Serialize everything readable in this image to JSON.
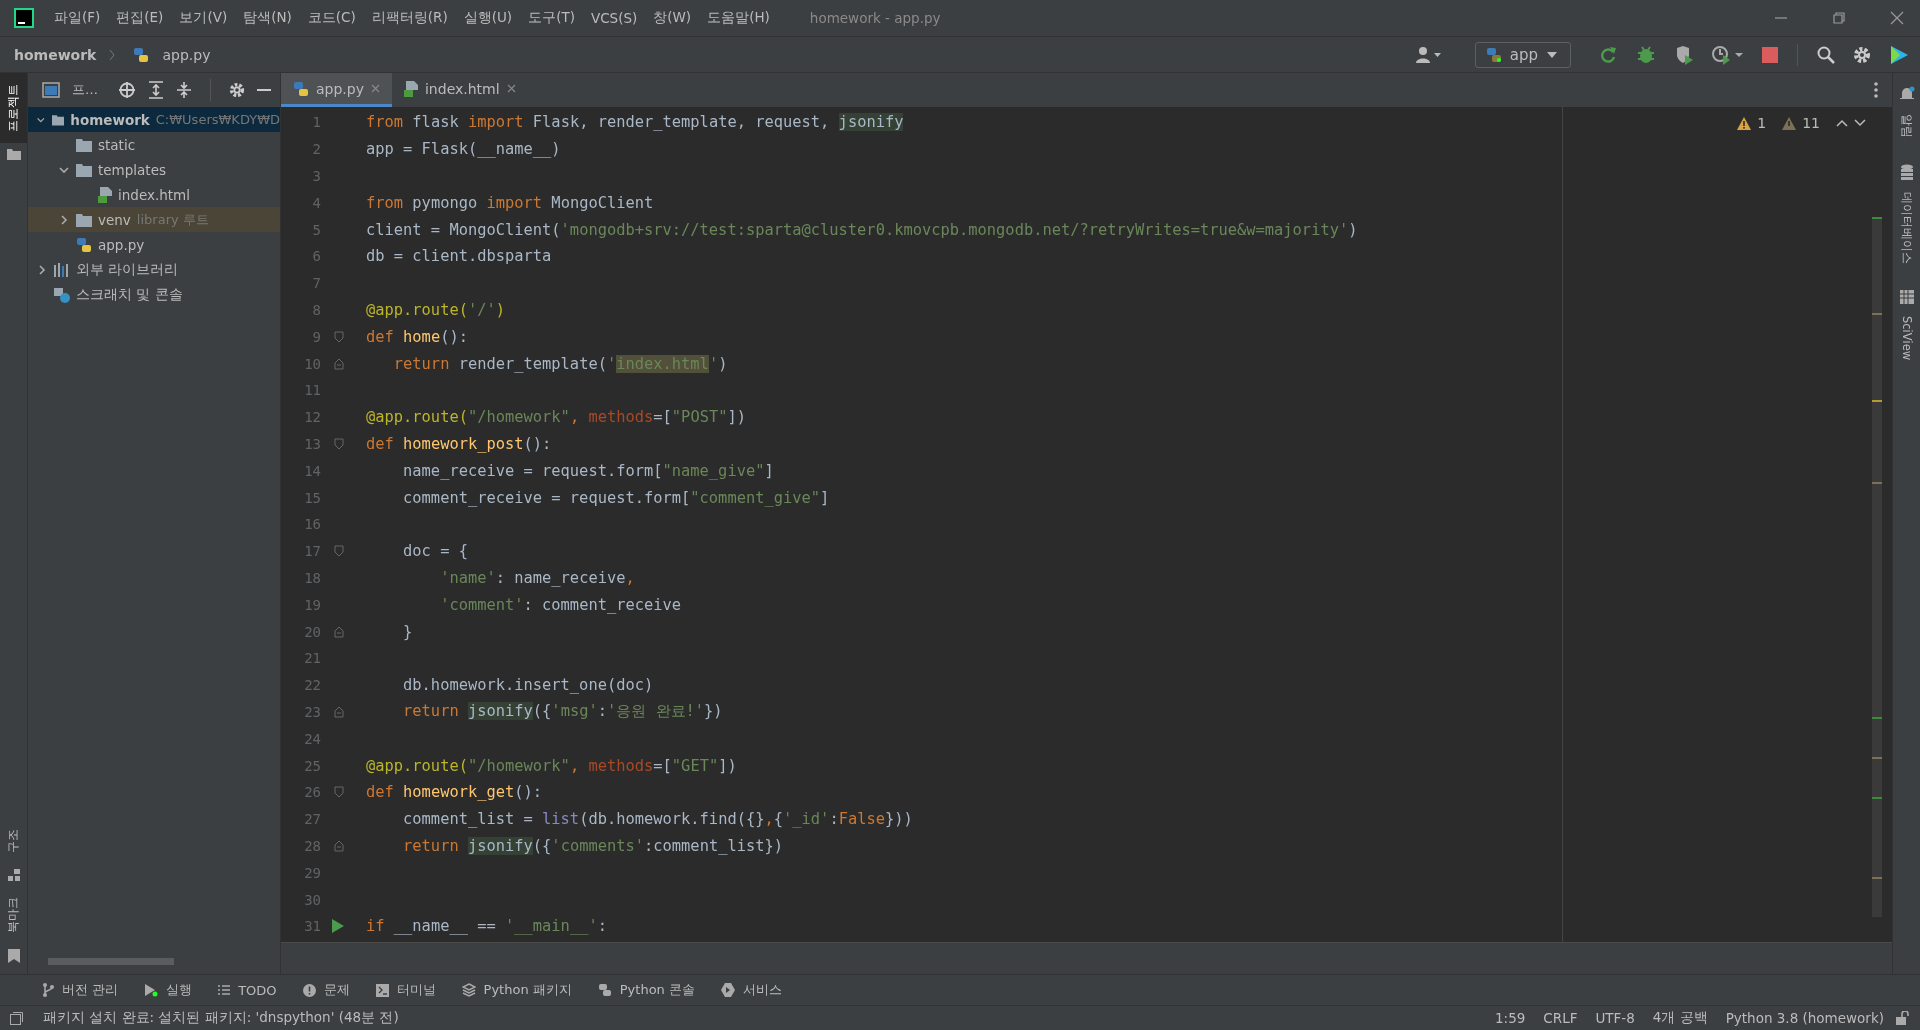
{
  "window": {
    "title": "homework - app.py"
  },
  "menu": [
    "파일(F)",
    "편집(E)",
    "보기(V)",
    "탐색(N)",
    "코드(C)",
    "리팩터링(R)",
    "실행(U)",
    "도구(T)",
    "VCS(S)",
    "창(W)",
    "도움말(H)"
  ],
  "breadcrumb": [
    "homework",
    "app.py"
  ],
  "run_config": "app",
  "left_strip": {
    "top": [
      "프로젝트"
    ],
    "bottom": [
      "구조",
      "북마크"
    ]
  },
  "right_strip": [
    "알림",
    "데이터베이스",
    "SciView"
  ],
  "project_panel": {
    "title": "프…",
    "tree": [
      {
        "label": "homework",
        "hint": "C:₩Users₩KDY₩D",
        "kind": "root",
        "expanded": true,
        "selected": true,
        "children": [
          {
            "label": "static",
            "kind": "folder",
            "selected": false
          },
          {
            "label": "templates",
            "kind": "folder",
            "expanded": true,
            "selected": false,
            "children": [
              {
                "label": "index.html",
                "kind": "html",
                "selected": false
              }
            ]
          },
          {
            "label": "venv",
            "hint": "library 루트",
            "kind": "folder",
            "expanded": false,
            "selected": false
          },
          {
            "label": "app.py",
            "kind": "python",
            "selected": false
          }
        ]
      },
      {
        "label": "외부 라이브러리",
        "kind": "libraries",
        "expanded": false,
        "selected": false
      },
      {
        "label": "스크래치 및 콘솔",
        "kind": "scratches",
        "selected": false
      }
    ]
  },
  "tabs": [
    {
      "label": "app.py",
      "kind": "python",
      "selected": true
    },
    {
      "label": "index.html",
      "kind": "html",
      "selected": false
    }
  ],
  "inspections": {
    "warnings": "1",
    "weak_warnings": "11"
  },
  "code_lines": [
    {
      "number": "1",
      "tokens": [
        {
          "text": "from",
          "kind": "kw"
        },
        {
          "text": " flask ",
          "kind": "plain"
        },
        {
          "text": "import",
          "kind": "kw"
        },
        {
          "text": " Flask, render_template, request, ",
          "kind": "plain"
        },
        {
          "text": "jsonify",
          "kind": "hl"
        }
      ]
    },
    {
      "number": "2",
      "tokens": [
        {
          "text": "app = Flask(__name__)",
          "kind": "plain"
        }
      ]
    },
    {
      "number": "3"
    },
    {
      "number": "4",
      "tokens": [
        {
          "text": "from",
          "kind": "kw"
        },
        {
          "text": " pymongo ",
          "kind": "plain"
        },
        {
          "text": "import",
          "kind": "kw"
        },
        {
          "text": " MongoClient",
          "kind": "plain"
        }
      ]
    },
    {
      "number": "5",
      "tokens": [
        {
          "text": "client = MongoClient(",
          "kind": "plain"
        },
        {
          "text": "'mongodb+srv://test:sparta@cluster0.kmovcpb.mongodb.net/?retryWrites=true&w=majority'",
          "kind": "str"
        },
        {
          "text": ")",
          "kind": "plain"
        }
      ]
    },
    {
      "number": "6",
      "tokens": [
        {
          "text": "db = client.dbsparta",
          "kind": "plain"
        }
      ]
    },
    {
      "number": "7"
    },
    {
      "number": "8",
      "tokens": [
        {
          "text": "@app.route(",
          "kind": "dec"
        },
        {
          "text": "'/'",
          "kind": "str"
        },
        {
          "text": ")",
          "kind": "dec"
        }
      ]
    },
    {
      "number": "9",
      "fold_start": true,
      "tokens": [
        {
          "text": "def ",
          "kind": "kw"
        },
        {
          "text": "home",
          "kind": "fn"
        },
        {
          "text": "():",
          "kind": "plain"
        }
      ]
    },
    {
      "number": "10",
      "fold_end": true,
      "tokens": [
        {
          "text": "   return",
          "kind": "kw"
        },
        {
          "text": " render_template(",
          "kind": "plain"
        },
        {
          "text": "'",
          "kind": "str"
        },
        {
          "text": "index.html",
          "kind": "strhl"
        },
        {
          "text": "'",
          "kind": "str"
        },
        {
          "text": ")",
          "kind": "plain"
        }
      ]
    },
    {
      "number": "11"
    },
    {
      "number": "12",
      "tokens": [
        {
          "text": "@app.route(",
          "kind": "dec"
        },
        {
          "text": "\"/homework\"",
          "kind": "str"
        },
        {
          "text": ", ",
          "kind": "kw"
        },
        {
          "text": "methods",
          "kind": "param"
        },
        {
          "text": "=[",
          "kind": "plain"
        },
        {
          "text": "\"POST\"",
          "kind": "str"
        },
        {
          "text": "])",
          "kind": "plain"
        }
      ]
    },
    {
      "number": "13",
      "fold_start": true,
      "tokens": [
        {
          "text": "def ",
          "kind": "kw"
        },
        {
          "text": "homework_post",
          "kind": "fn"
        },
        {
          "text": "():",
          "kind": "plain"
        }
      ]
    },
    {
      "number": "14",
      "tokens": [
        {
          "text": "    name_receive = request.form[",
          "kind": "plain"
        },
        {
          "text": "\"name_give\"",
          "kind": "str"
        },
        {
          "text": "]",
          "kind": "plain"
        }
      ]
    },
    {
      "number": "15",
      "tokens": [
        {
          "text": "    comment_receive = request.form[",
          "kind": "plain"
        },
        {
          "text": "\"comment_give\"",
          "kind": "str"
        },
        {
          "text": "]",
          "kind": "plain"
        }
      ]
    },
    {
      "number": "16"
    },
    {
      "number": "17",
      "fold_start": true,
      "tokens": [
        {
          "text": "    doc = {",
          "kind": "plain"
        }
      ]
    },
    {
      "number": "18",
      "tokens": [
        {
          "text": "        'name'",
          "kind": "str"
        },
        {
          "text": ": name_receive",
          "kind": "plain"
        },
        {
          "text": ",",
          "kind": "kw"
        }
      ]
    },
    {
      "number": "19",
      "tokens": [
        {
          "text": "        'comment'",
          "kind": "str"
        },
        {
          "text": ": comment_receive",
          "kind": "plain"
        }
      ]
    },
    {
      "number": "20",
      "fold_end": true,
      "tokens": [
        {
          "text": "    }",
          "kind": "plain"
        }
      ]
    },
    {
      "number": "21"
    },
    {
      "number": "22",
      "tokens": [
        {
          "text": "    db.homework.insert_one(doc)",
          "kind": "plain"
        }
      ]
    },
    {
      "number": "23",
      "fold_end": true,
      "tokens": [
        {
          "text": "    return ",
          "kind": "kw"
        },
        {
          "text": "jsonify",
          "kind": "hl"
        },
        {
          "text": "({",
          "kind": "plain"
        },
        {
          "text": "'msg'",
          "kind": "str"
        },
        {
          "text": ":",
          "kind": "plain"
        },
        {
          "text": "'응원 완료!'",
          "kind": "str"
        },
        {
          "text": "})",
          "kind": "plain"
        }
      ]
    },
    {
      "number": "24"
    },
    {
      "number": "25",
      "tokens": [
        {
          "text": "@app.route(",
          "kind": "dec"
        },
        {
          "text": "\"/homework\"",
          "kind": "str"
        },
        {
          "text": ", ",
          "kind": "kw"
        },
        {
          "text": "methods",
          "kind": "param"
        },
        {
          "text": "=[",
          "kind": "plain"
        },
        {
          "text": "\"GET\"",
          "kind": "str"
        },
        {
          "text": "])",
          "kind": "plain"
        }
      ]
    },
    {
      "number": "26",
      "fold_start": true,
      "tokens": [
        {
          "text": "def ",
          "kind": "kw"
        },
        {
          "text": "homework_get",
          "kind": "fn"
        },
        {
          "text": "():",
          "kind": "plain"
        }
      ]
    },
    {
      "number": "27",
      "tokens": [
        {
          "text": "    comment_list = ",
          "kind": "plain"
        },
        {
          "text": "list",
          "kind": "builtin"
        },
        {
          "text": "(db.homework.find({}",
          "kind": "plain"
        },
        {
          "text": ",",
          "kind": "kw"
        },
        {
          "text": "{",
          "kind": "plain"
        },
        {
          "text": "'_id'",
          "kind": "str"
        },
        {
          "text": ":",
          "kind": "plain"
        },
        {
          "text": "False",
          "kind": "kw"
        },
        {
          "text": "}))",
          "kind": "plain"
        }
      ]
    },
    {
      "number": "28",
      "fold_end": true,
      "tokens": [
        {
          "text": "    return ",
          "kind": "kw"
        },
        {
          "text": "jsonify",
          "kind": "hl"
        },
        {
          "text": "({",
          "kind": "plain"
        },
        {
          "text": "'comments'",
          "kind": "str"
        },
        {
          "text": ":comment_list})",
          "kind": "plain"
        }
      ]
    },
    {
      "number": "29"
    },
    {
      "number": "30"
    },
    {
      "number": "31",
      "run": true,
      "tokens": [
        {
          "text": "if",
          "kind": "kw"
        },
        {
          "text": " __name__ == ",
          "kind": "plain"
        },
        {
          "text": "'__main__'",
          "kind": "str"
        },
        {
          "text": ":",
          "kind": "plain"
        }
      ]
    }
  ],
  "tool_windows": [
    {
      "label": "버전 관리",
      "kind": "vcs"
    },
    {
      "label": "실행",
      "kind": "run"
    },
    {
      "label": "TODO",
      "kind": "todo"
    },
    {
      "label": "문제",
      "kind": "problems"
    },
    {
      "label": "터미널",
      "kind": "terminal"
    },
    {
      "label": "Python 패키지",
      "kind": "packages"
    },
    {
      "label": "Python 콘솔",
      "kind": "console"
    },
    {
      "label": "서비스",
      "kind": "services"
    }
  ],
  "status_bar": {
    "message": "패키지 설치 완료: 설치된 패키지: 'dnspython' (48분 전)",
    "items": [
      "1:59",
      "CRLF",
      "UTF-8",
      "4개 공백",
      "Python 3.8 (homework)"
    ]
  }
}
